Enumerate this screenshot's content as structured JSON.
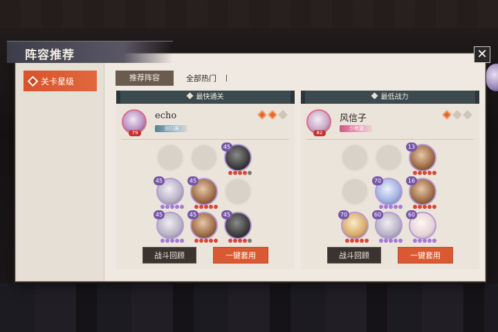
{
  "title": "阵容推荐",
  "close_label": "✕",
  "sidebar": {
    "stage_label": "关卡星级"
  },
  "tabs": [
    {
      "label": "推荐阵容",
      "active": true
    },
    {
      "label": "全部热门",
      "active": false
    }
  ],
  "cards": [
    {
      "header": "最快通关",
      "player": {
        "name": "echo",
        "level": "79",
        "tag": "回归客"
      },
      "stars": [
        true,
        true,
        false
      ],
      "heroes": [
        {
          "row": 0,
          "col": 0,
          "empty": true
        },
        {
          "row": 0,
          "col": 1,
          "empty": true
        },
        {
          "row": 0,
          "col": 2,
          "level": "45",
          "tone": "dark"
        },
        {
          "row": 1,
          "col": 0,
          "level": "45",
          "tone": "silver"
        },
        {
          "row": 1,
          "col": 1,
          "level": "45",
          "tone": "brown"
        },
        {
          "row": 1,
          "col": 2,
          "empty": true
        },
        {
          "row": 2,
          "col": 0,
          "level": "45",
          "tone": "silver"
        },
        {
          "row": 2,
          "col": 1,
          "level": "45",
          "tone": "brown"
        },
        {
          "row": 2,
          "col": 2,
          "level": "45",
          "tone": "dark"
        }
      ],
      "replay_label": "战斗回顾",
      "apply_label": "一键套用"
    },
    {
      "header": "最低战力",
      "player": {
        "name": "风信子",
        "level": "82",
        "tag": "少年游"
      },
      "stars": [
        true,
        false,
        false
      ],
      "heroes": [
        {
          "row": 0,
          "col": 0,
          "empty": true
        },
        {
          "row": 0,
          "col": 1,
          "empty": true
        },
        {
          "row": 0,
          "col": 2,
          "level": "13",
          "tone": "brown"
        },
        {
          "row": 1,
          "col": 0,
          "empty": true
        },
        {
          "row": 1,
          "col": 1,
          "level": "70",
          "tone": "blue"
        },
        {
          "row": 1,
          "col": 2,
          "level": "16",
          "tone": "brown"
        },
        {
          "row": 2,
          "col": 0,
          "level": "70",
          "tone": "gold"
        },
        {
          "row": 2,
          "col": 1,
          "level": "60",
          "tone": "silver"
        },
        {
          "row": 2,
          "col": 2,
          "level": "60",
          "tone": "light"
        }
      ],
      "replay_label": "战斗回顾",
      "apply_label": "一键套用"
    }
  ],
  "colors": {
    "accent": "#d95a32",
    "header": "#3c4a4f",
    "panel": "#efe9e1"
  }
}
